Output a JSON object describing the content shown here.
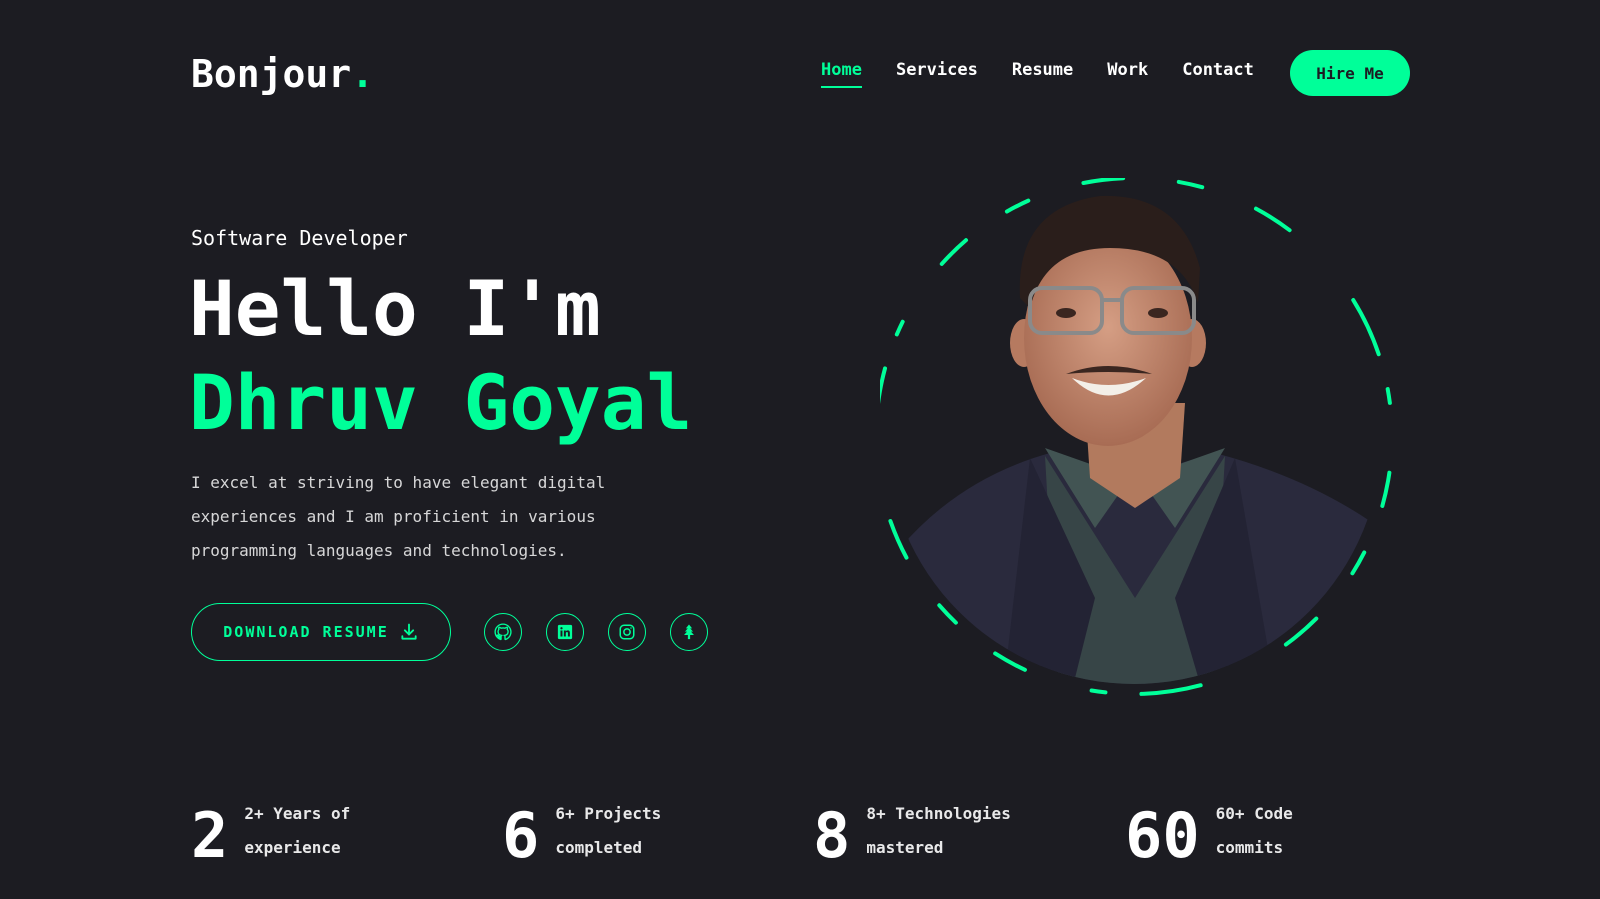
{
  "header": {
    "logo_text": "Bonjour",
    "logo_dot": ".",
    "nav": [
      "Home",
      "Services",
      "Resume",
      "Work",
      "Contact"
    ],
    "active_nav": "Home",
    "hire_label": "Hire Me"
  },
  "hero": {
    "subtitle": "Software Developer",
    "greeting": "Hello I'm",
    "name": "Dhruv Goyal",
    "description": "I excel at striving to have elegant digital experiences and I am proficient in various programming languages and technologies.",
    "download_label": "DOWNLOAD RESUME",
    "socials": [
      "github-icon",
      "linkedin-icon",
      "instagram-icon",
      "linktree-icon"
    ]
  },
  "stats": [
    {
      "number": "2",
      "label_line1": "2+ Years of",
      "label_line2": "experience"
    },
    {
      "number": "6",
      "label_line1": "6+ Projects",
      "label_line2": "completed"
    },
    {
      "number": "8",
      "label_line1": "8+ Technologies",
      "label_line2": "mastered"
    },
    {
      "number": "60",
      "label_line1": "60+ Code",
      "label_line2": "commits"
    }
  ],
  "colors": {
    "background": "#1c1c22",
    "accent": "#00ff99",
    "text": "#ffffff"
  }
}
